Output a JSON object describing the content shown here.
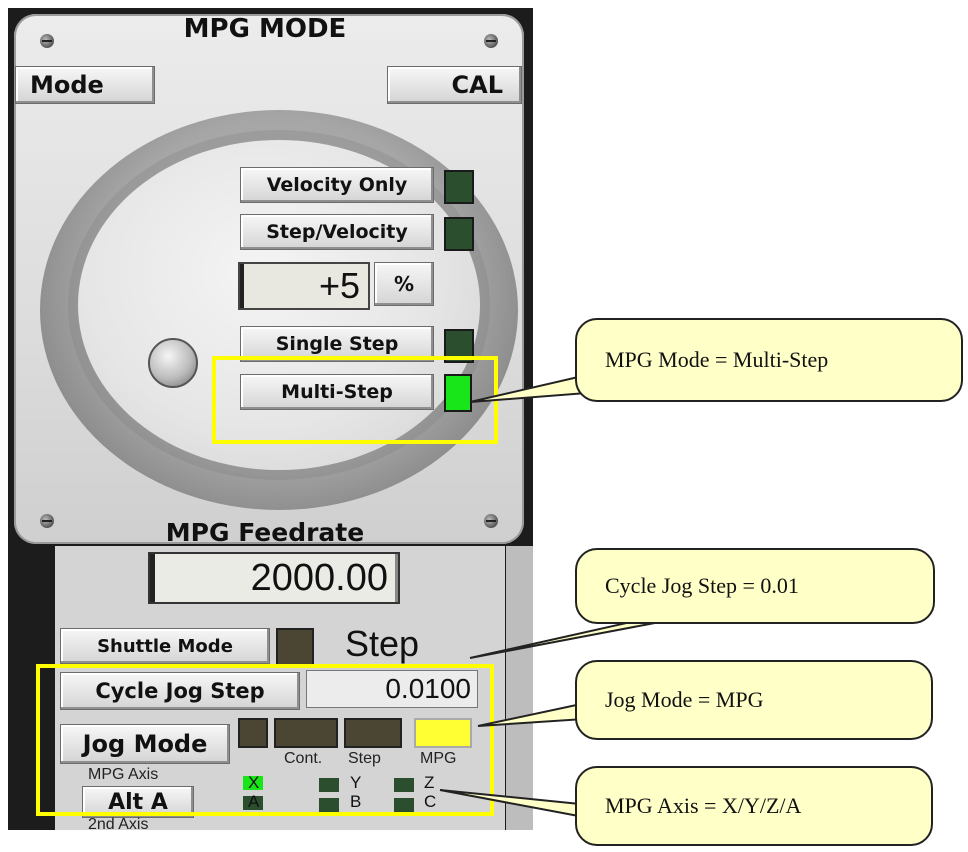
{
  "mpg_panel": {
    "title": "MPG MODE",
    "mode_button": "Mode",
    "cal_button": "CAL",
    "velocity_only_button": "Velocity Only",
    "step_velocity_button": "Step/Velocity",
    "step_percent_value": "+5",
    "percent_button": "%",
    "single_step_button": "Single Step",
    "multi_step_button": "Multi-Step"
  },
  "feedrate": {
    "title": "MPG Feedrate",
    "value": "2000.00"
  },
  "jog": {
    "shuttle_mode_button": "Shuttle Mode",
    "shuttle_mode_state": "Step",
    "cycle_jog_step_button": "Cycle Jog Step",
    "cycle_jog_step_value": "0.0100",
    "jog_mode_button": "Jog Mode",
    "jog_mode_labels": [
      "Cont.",
      "Step",
      "MPG"
    ],
    "mpg_axis_label": "MPG Axis",
    "alt_a_button": "Alt A",
    "second_axis_label": "2nd Axis",
    "axis_labels": [
      "X",
      "Y",
      "Z",
      "A",
      "B",
      "C"
    ]
  },
  "callouts": {
    "mpg_mode": "MPG Mode = Multi-Step",
    "cycle_jog_step": "Cycle Jog Step = 0.01",
    "jog_mode": "Jog Mode = MPG",
    "mpg_axis": "MPG Axis = X/Y/Z/A"
  },
  "colors": {
    "led_on_green": "#19e619",
    "led_off": "#2b4f2e",
    "mpg_led_on": "#ffff33",
    "highlight": "#ffff00",
    "callout_fill": "#ffffc8"
  }
}
